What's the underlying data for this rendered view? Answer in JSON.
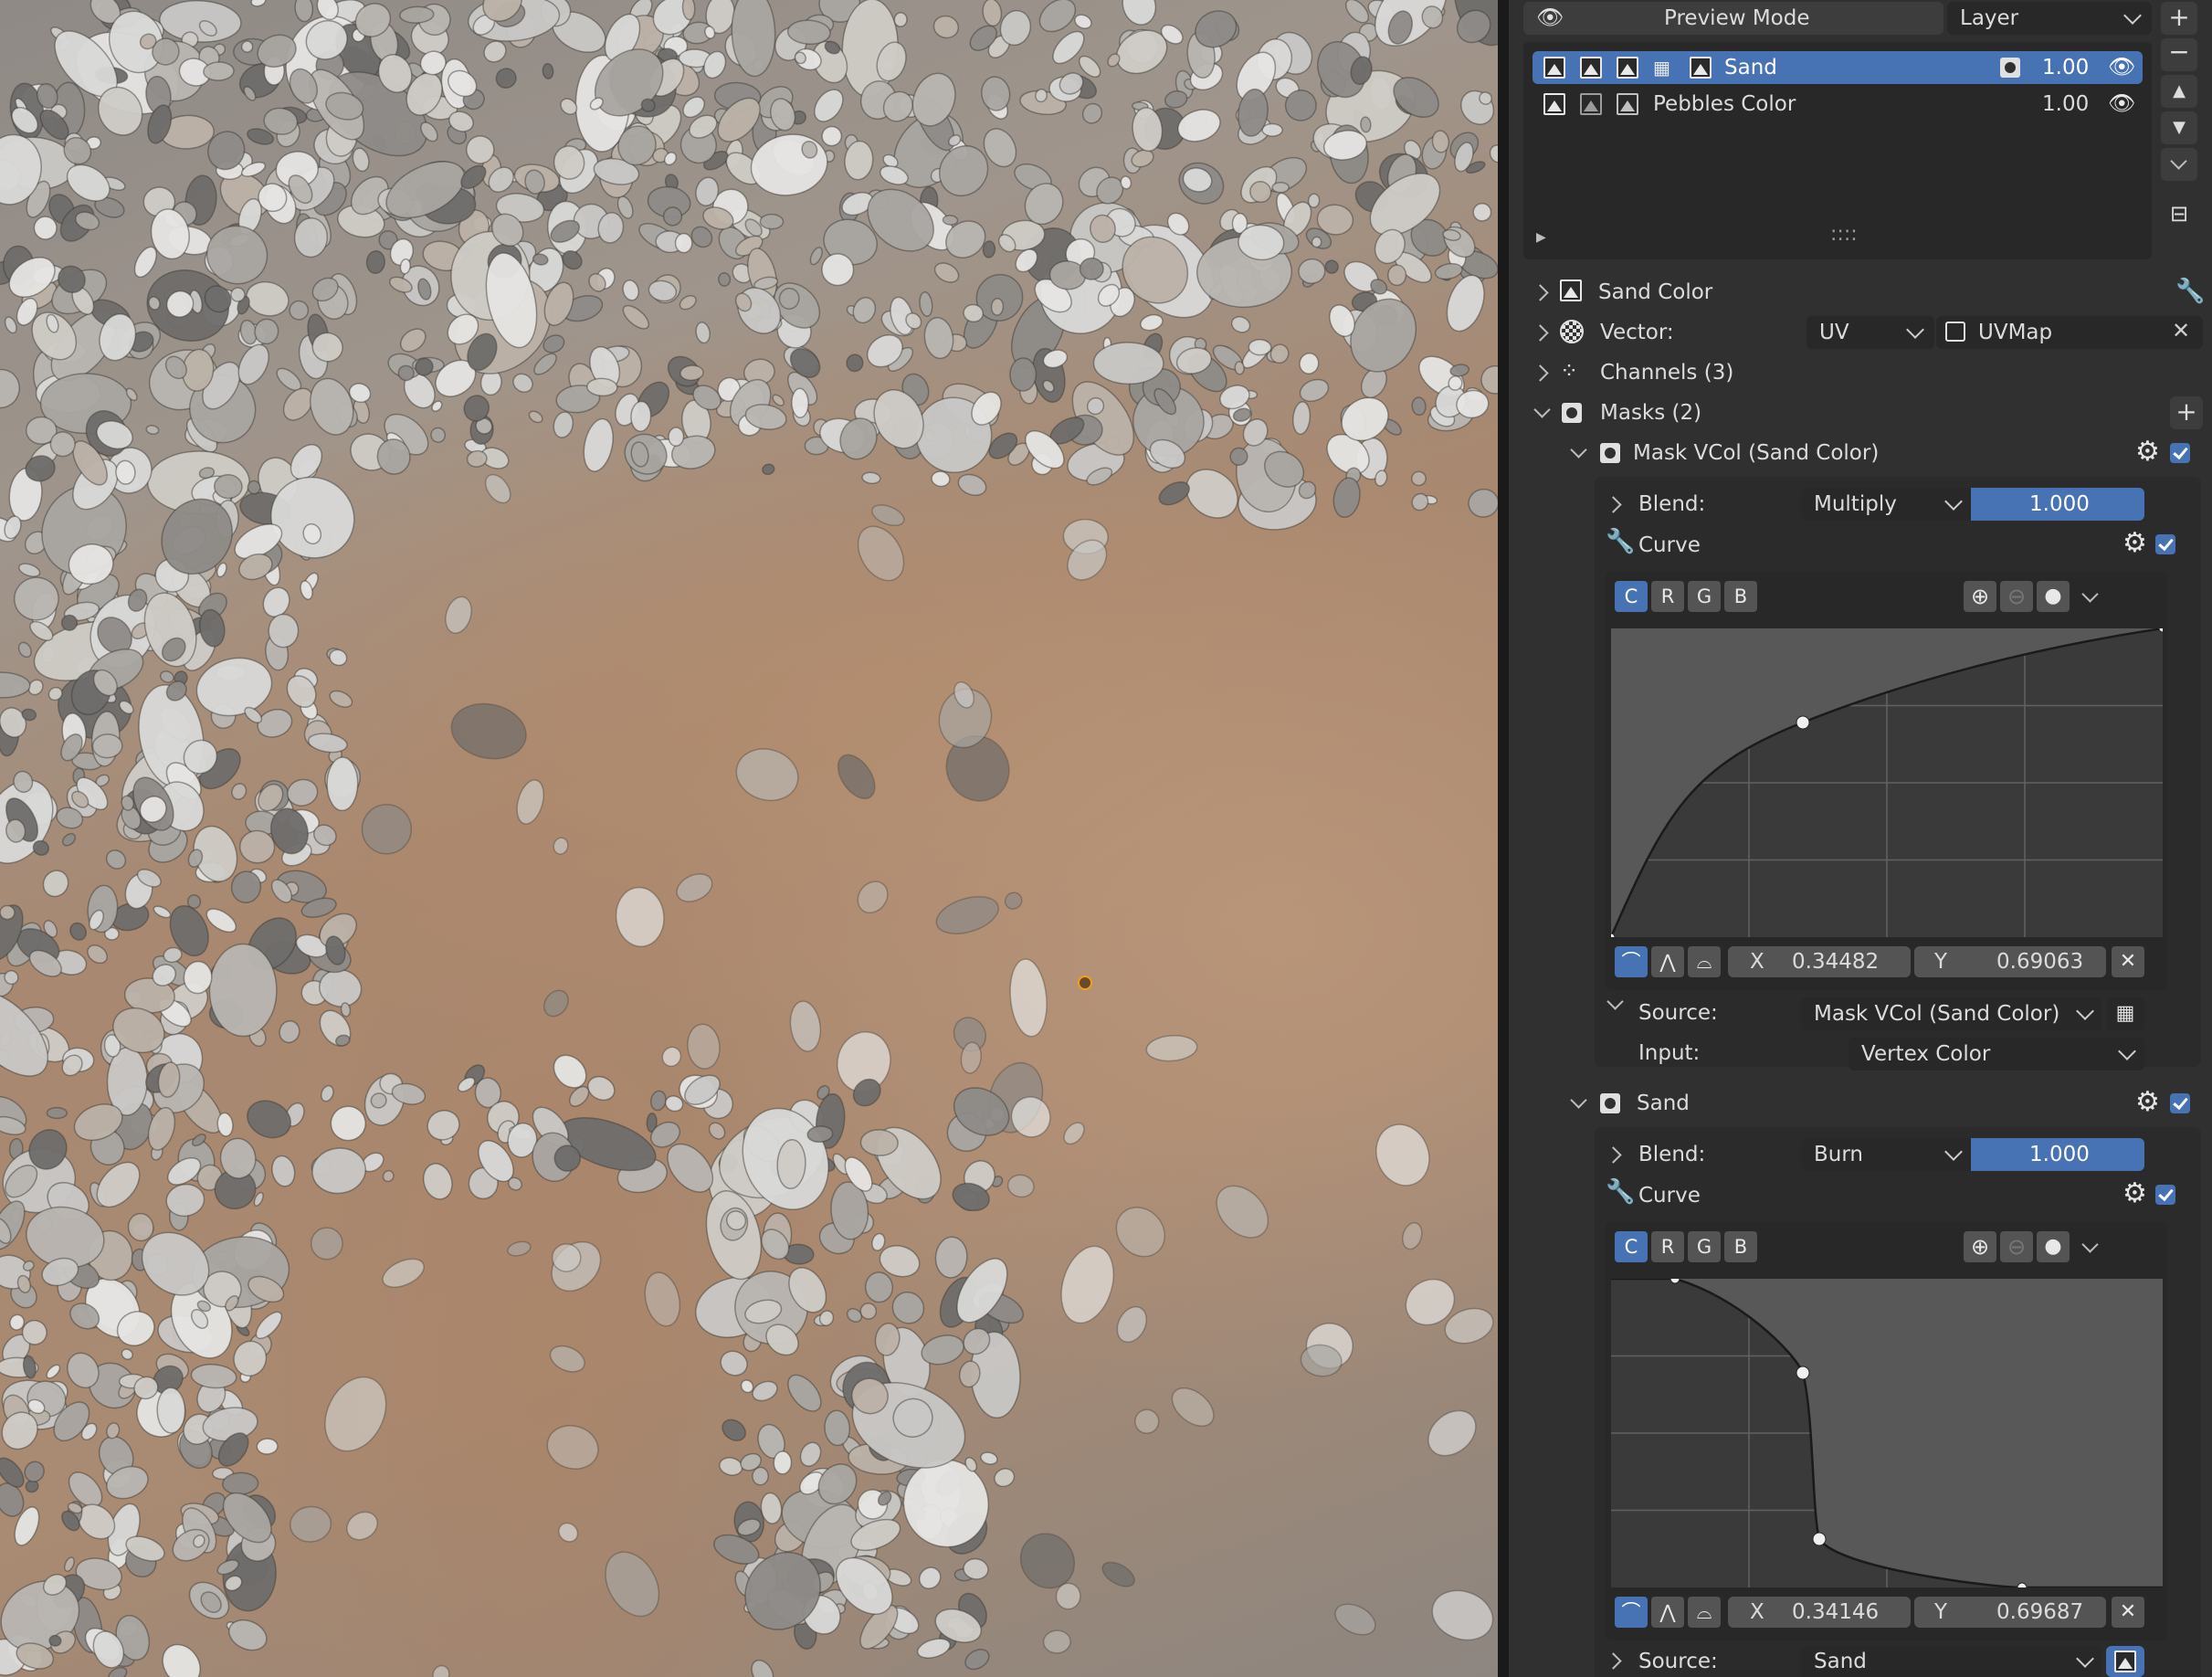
{
  "layer_list": {
    "preview_mode_label": "Preview Mode",
    "type_dropdown": "Layer",
    "layers": [
      {
        "name": "Sand",
        "opacity": "1.00",
        "selected": true
      },
      {
        "name": "Pebbles Color",
        "opacity": "1.00",
        "selected": false
      }
    ],
    "resize_handle": "::::"
  },
  "sections": {
    "sand_color": "Sand Color",
    "vector_label": "Vector:",
    "vector_mode": "UV",
    "uv_map": "UVMap",
    "channels": "Channels (3)",
    "masks": "Masks (2)"
  },
  "masks": [
    {
      "title": "Mask VCol (Sand Color)",
      "blend_label": "Blend:",
      "blend_mode": "Multiply",
      "blend_value": "1.000",
      "curve_label": "Curve",
      "channels": [
        "C",
        "R",
        "G",
        "B"
      ],
      "point_x_label": "X",
      "point_x": "0.34482",
      "point_y_label": "Y",
      "point_y": "0.69063",
      "source_label": "Source:",
      "source_value": "Mask VCol (Sand Color)",
      "input_label": "Input:",
      "input_value": "Vertex Color"
    },
    {
      "title": "Sand",
      "blend_label": "Blend:",
      "blend_mode": "Burn",
      "blend_value": "1.000",
      "curve_label": "Curve",
      "channels": [
        "C",
        "R",
        "G",
        "B"
      ],
      "point_x_label": "X",
      "point_x": "0.34146",
      "point_y_label": "Y",
      "point_y": "0.69687",
      "source_label": "Source:",
      "source_value": "Sand"
    }
  ],
  "colors": {
    "accent": "#4772b3",
    "panel_bg": "#303030",
    "field_bg": "#1d1d1d",
    "button_bg": "#545454",
    "graph_bg": "#585858"
  }
}
